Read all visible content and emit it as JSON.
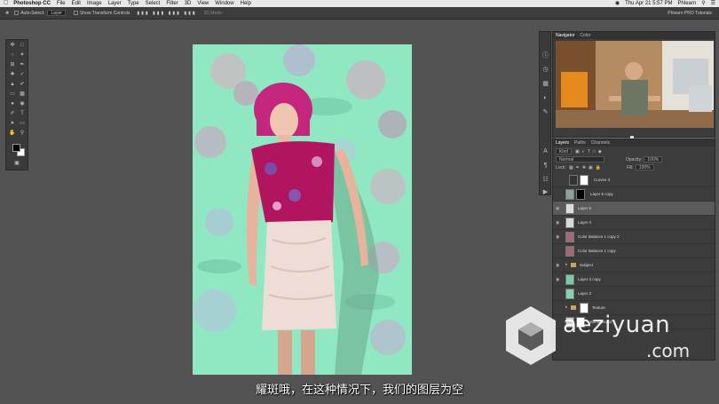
{
  "menubar": {
    "app": "Photoshop CC",
    "items": [
      "File",
      "Edit",
      "Image",
      "Layer",
      "Type",
      "Select",
      "Filter",
      "3D",
      "View",
      "Window",
      "Help"
    ],
    "right": [
      "Thu Apr 21 5:57 PM",
      "Phlearn"
    ]
  },
  "options": {
    "auto_select": "Auto-Select:",
    "target": "Layer",
    "transform": "Show Transform Controls",
    "mode3d": "3D Mode:",
    "workspace": "Phlearn PRO Tutorials"
  },
  "navigator": {
    "tabs": [
      "Navigator",
      "Color"
    ]
  },
  "layers": {
    "tabs": [
      "Layers",
      "Paths",
      "Channels"
    ],
    "kind": "Kind",
    "blend": "Normal",
    "opacity_label": "Opacity:",
    "opacity": "100%",
    "lock_label": "Lock:",
    "fill_label": "Fill:",
    "fill": "100%",
    "rows": [
      {
        "name": "Curves 3",
        "visible": false,
        "selected": false,
        "type": "adjust"
      },
      {
        "name": "Layer 6 copy",
        "visible": false,
        "selected": false,
        "type": "masked"
      },
      {
        "name": "Layer 5",
        "visible": true,
        "selected": true,
        "type": "pixel"
      },
      {
        "name": "Layer 4",
        "visible": true,
        "selected": false,
        "type": "pixel"
      },
      {
        "name": "Color Balance 1 copy 2",
        "visible": true,
        "selected": false,
        "type": "pixel"
      },
      {
        "name": "Color Balance 1 copy",
        "visible": false,
        "selected": false,
        "type": "pixel"
      },
      {
        "name": "Subject",
        "visible": true,
        "selected": false,
        "type": "folder"
      },
      {
        "name": "Layer 3 copy",
        "visible": true,
        "selected": false,
        "type": "pixel"
      },
      {
        "name": "Layer 3",
        "visible": false,
        "selected": false,
        "type": "pixel"
      },
      {
        "name": "Texture",
        "visible": false,
        "selected": false,
        "type": "folder"
      },
      {
        "name": "Background",
        "visible": false,
        "selected": false,
        "type": "pixel"
      }
    ]
  },
  "subtitle": "耀斑哦，在这种情况下，我们的图层为空",
  "watermark": {
    "text": "aeziyuan",
    "domain": ".com"
  }
}
